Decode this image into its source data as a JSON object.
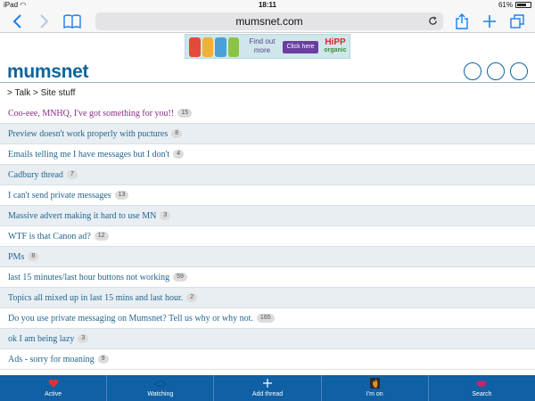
{
  "status_bar": {
    "device": "iPad",
    "time": "18:11",
    "battery": "61%",
    "battery_fraction": 0.61
  },
  "browser": {
    "url": "mumsnet.com",
    "back_icon": "chevron-left-icon",
    "forward_icon": "chevron-right-icon",
    "bookmarks_icon": "book-icon",
    "share_icon": "share-icon",
    "new_tab_icon": "plus-icon",
    "tabs_icon": "tabs-icon",
    "reload_icon": "reload-icon"
  },
  "ad": {
    "text": "Find out more",
    "button": "Click here",
    "brand_top": "HiPP",
    "brand_bottom": "organic"
  },
  "site": {
    "logo": "mumsnet"
  },
  "breadcrumb": "> Talk > Site stuff",
  "threads": [
    {
      "title": "Coo-eee, MNHQ, I've got something for you!!",
      "count": "15"
    },
    {
      "title": "Preview doesn't work properly with puctures",
      "count": "8"
    },
    {
      "title": "Emails telling me I have messages but I don't",
      "count": "4"
    },
    {
      "title": "Cadbury thread",
      "count": "7"
    },
    {
      "title": "I can't send private messages",
      "count": "13"
    },
    {
      "title": "Massive advert making it hard to use MN",
      "count": "3"
    },
    {
      "title": "WTF is that Canon ad?",
      "count": "12"
    },
    {
      "title": "PMs",
      "count": "8"
    },
    {
      "title": "last 15 minutes/last hour buttons not working",
      "count": "59"
    },
    {
      "title": "Topics all mixed up in last 15 mins and last hour.",
      "count": "2"
    },
    {
      "title": "Do you use private messaging on Mumsnet? Tell us why or why not.",
      "count": "165"
    },
    {
      "title": "ok I am being lazy",
      "count": "3"
    },
    {
      "title": "Ads - sorry for moaning",
      "count": "9"
    }
  ],
  "bottom_nav": [
    {
      "label": "Active",
      "icon": "heart-icon"
    },
    {
      "label": "Watching",
      "icon": "eye-icon"
    },
    {
      "label": "Add thread",
      "icon": "plus-icon"
    },
    {
      "label": "I'm on",
      "icon": "flame-icon"
    },
    {
      "label": "Search",
      "icon": "lips-icon"
    }
  ],
  "colors": {
    "brand": "#10649b",
    "link": "#23668f",
    "visited": "#8b2a87",
    "nav_bg": "#0f60a4",
    "row_alt": "#e8eef2"
  }
}
